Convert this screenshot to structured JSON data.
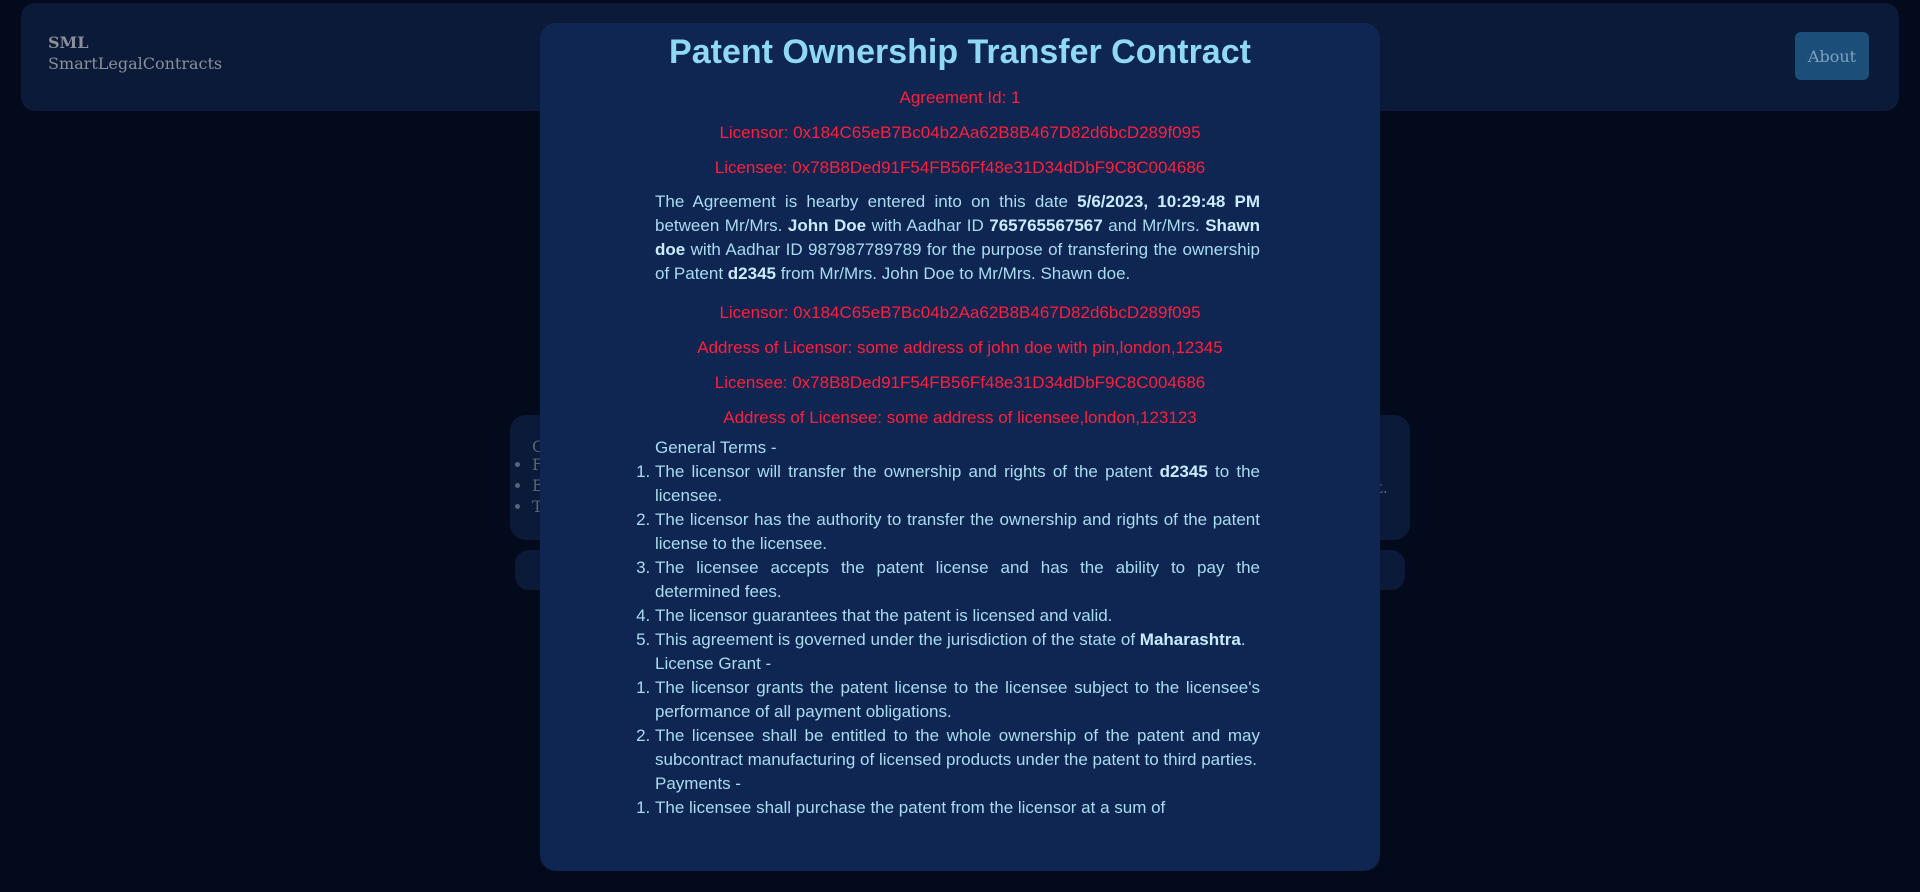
{
  "navbar": {
    "brand_short": "SML",
    "brand_long": "SmartLegalContracts",
    "about_label": "About"
  },
  "background_card": {
    "line0": "C",
    "items": [
      "F",
      "E",
      "T"
    ],
    "tail": "t."
  },
  "modal": {
    "title": "Patent Ownership Transfer Contract",
    "agreement_id": "Agreement Id: 1",
    "licensor": "Licensor: 0x184C65eB7Bc04b2Aa62B8B467D82d6bcD289f095",
    "licensee": "Licensee: 0x78B8Ded91F54FB56Ff48e31D34dDbF9C8C004686",
    "agreement": {
      "p1": "The Agreement is hearby entered into on this date ",
      "date": "5/6/2023, 10:29:48 PM",
      "p2": " between Mr/Mrs. ",
      "party1": "John Doe",
      "p3": " with Aadhar ID ",
      "aadhar1": "765765567567",
      "p4": " and Mr/Mrs. ",
      "party2": "Shawn doe",
      "p5": " with Aadhar ID 987987789789 for the purpose of transfering the ownership of Patent ",
      "patent": "d2345",
      "p6": " from Mr/Mrs. John Doe to Mr/Mrs. Shawn doe."
    },
    "licensor2": "Licensor: 0x184C65eB7Bc04b2Aa62B8B467D82d6bcD289f095",
    "licensor_address": "Address of Licensor: some address of john doe with pin,london,12345",
    "licensee2": "Licensee: 0x78B8Ded91F54FB56Ff48e31D34dDbF9C8C004686",
    "licensee_address": "Address of Licensee: some address of licensee,london,123123",
    "general_terms_heading": "General Terms -",
    "general_terms": {
      "t1a": "The licensor will transfer the ownership and rights of the patent ",
      "t1b": "d2345",
      "t1c": " to the licensee.",
      "t2": "The licensor has the authority to transfer the ownership and rights of the patent license to the licensee.",
      "t3": "The licensee accepts the patent license and has the ability to pay the determined fees.",
      "t4": "The licensor guarantees that the patent is licensed and valid.",
      "t5a": "This agreement is governed under the jurisdiction of the state of ",
      "t5b": "Maharashtra",
      "t5c": "."
    },
    "license_grant_heading": "License Grant -",
    "license_grant": [
      "The licensor grants the patent license to the licensee subject to the licensee's performance of all payment obligations.",
      "The licensee shall be entitled to the whole ownership of the patent and may subcontract manufacturing of licensed products under the patent to third parties."
    ],
    "payments_heading": "Payments -",
    "payments": [
      "The licensee shall purchase the patent from the licensor at a sum of"
    ]
  }
}
